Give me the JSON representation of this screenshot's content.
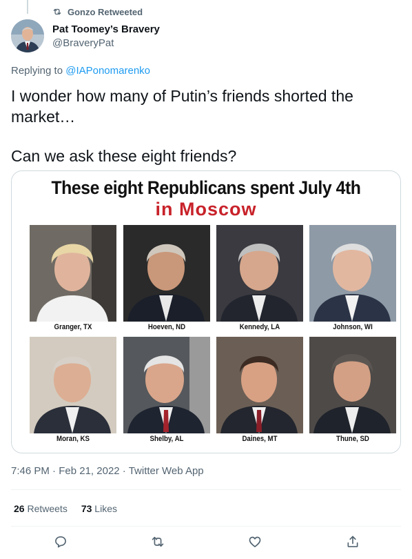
{
  "retweet": {
    "text": "Gonzo Retweeted"
  },
  "author": {
    "name": "Pat Toomey’s Bravery",
    "handle": "@BraveryPat"
  },
  "reply": {
    "prefix": "Replying to ",
    "handle": "@IAPonomarenko"
  },
  "tweet": {
    "line1": "I wonder how many of Putin’s friends shorted the market…",
    "line2": "Can we ask these eight friends?"
  },
  "media": {
    "title": "These eight Republicans spent July 4th",
    "subtitle": "in Moscow",
    "photos": [
      {
        "caption": "Granger, TX"
      },
      {
        "caption": "Hoeven, ND"
      },
      {
        "caption": "Kennedy, LA"
      },
      {
        "caption": "Johnson, WI"
      },
      {
        "caption": "Moran, KS"
      },
      {
        "caption": "Shelby, AL"
      },
      {
        "caption": "Daines, MT"
      },
      {
        "caption": "Thune, SD"
      }
    ]
  },
  "meta": {
    "time": "7:46 PM",
    "sep1": " · ",
    "date": "Feb 21, 2022",
    "sep2": " · ",
    "source": "Twitter Web App"
  },
  "stats": {
    "retweets_count": "26",
    "retweets_label": " Retweets",
    "likes_count": "73",
    "likes_label": " Likes"
  },
  "actions": {
    "reply_icon": "reply-icon",
    "retweet_icon": "retweet-icon",
    "like_icon": "heart-icon",
    "share_icon": "share-icon"
  },
  "colors": {
    "link": "#1d9bf0",
    "muted": "#536471",
    "text": "#0f1419",
    "moscow_red": "#c8222a"
  }
}
